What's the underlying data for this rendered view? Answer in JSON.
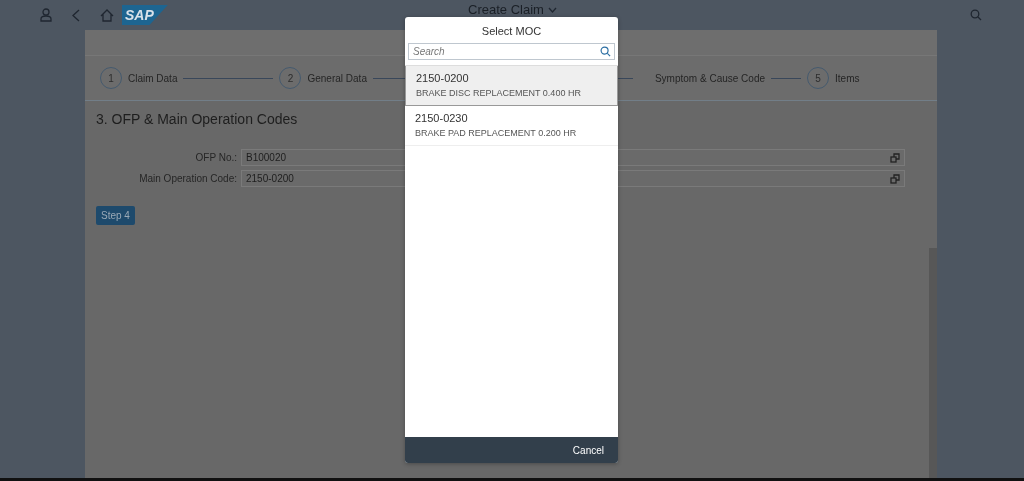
{
  "shell": {
    "title": "Create Claim",
    "logo": "SAP"
  },
  "wizard": {
    "steps": [
      {
        "number": "1",
        "label": "Claim Data"
      },
      {
        "number": "2",
        "label": "General Data"
      },
      {
        "label": "Symptom & Cause Code"
      },
      {
        "number": "5",
        "label": "Items"
      }
    ]
  },
  "section": {
    "title": "3. OFP & Main Operation Codes",
    "fields": [
      {
        "label": "OFP No.:",
        "value": "B100020"
      },
      {
        "label": "Main Operation Code:",
        "value": "2150-0200"
      }
    ],
    "button": "Step 4"
  },
  "dialog": {
    "title": "Select MOC",
    "search": {
      "placeholder": "Search"
    },
    "items": [
      {
        "code": "2150-0200",
        "description": "BRAKE DISC REPLACEMENT 0.400 HR",
        "selected": true
      },
      {
        "code": "2150-0230",
        "description": "BRAKE PAD REPLACEMENT 0.200 HR",
        "selected": false
      }
    ],
    "cancel": "Cancel"
  }
}
